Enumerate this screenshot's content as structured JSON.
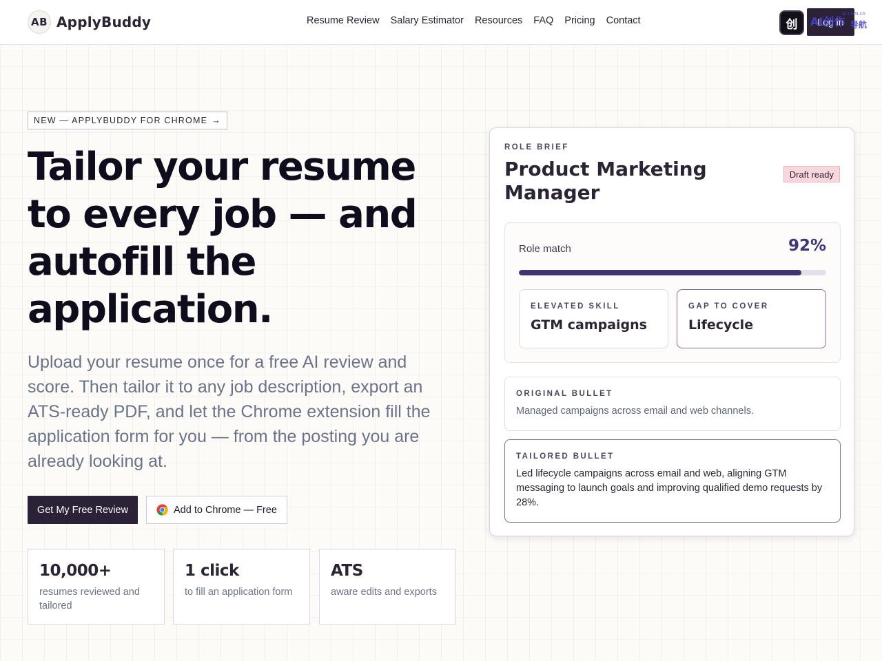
{
  "header": {
    "logo_initials": "AB",
    "brand_name": "ApplyBuddy",
    "nav": [
      "Resume Review",
      "Salary Estimator",
      "Resources",
      "FAQ",
      "Pricing",
      "Contact"
    ],
    "login_label": "Log in"
  },
  "overlay": {
    "badge_glyph": "创",
    "text": "AI创作",
    "small_text": "ai.com.cn",
    "sub_text": "导航"
  },
  "hero": {
    "pill_text": "NEW — APPLYBUDDY FOR CHROME",
    "pill_arrow": "→",
    "title": "Tailor your resume to every job — and autofill the application.",
    "subtitle": "Upload your resume once for a free AI review and score. Then tailor it to any job description, export an ATS-ready PDF, and let the Chrome extension fill the application form for you — from the posting you are already looking at.",
    "cta_primary": "Get My Free Review",
    "cta_secondary": "Add to Chrome — Free"
  },
  "stats": [
    {
      "value": "10,000+",
      "caption": "resumes reviewed and tailored"
    },
    {
      "value": "1 click",
      "caption": "to fill an application form"
    },
    {
      "value": "ATS",
      "caption": "aware edits and exports"
    }
  ],
  "card": {
    "eyebrow": "ROLE BRIEF",
    "title": "Product Marketing Manager",
    "status": "Draft ready",
    "match_label": "Role match",
    "match_value": "92%",
    "match_fraction": 0.92,
    "elevated_label": "ELEVATED SKILL",
    "elevated_value": "GTM campaigns",
    "gap_label": "GAP TO COVER",
    "gap_value": "Lifecycle",
    "original_label": "ORIGINAL BULLET",
    "original_text": "Managed campaigns across email and web channels.",
    "tailored_label": "TAILORED BULLET",
    "tailored_text": "Led lifecycle campaigns across email and web, aligning GTM messaging to launch goals and improving qualified demo requests by 28%."
  },
  "colors": {
    "primary": "#2b2238",
    "accent": "#3e3573",
    "badge_bg": "#f9d7dd",
    "highlight_border": "#8c6b9c"
  },
  "icons": {
    "pill_arrow": "arrow-right-icon",
    "chrome": "chrome-icon"
  }
}
